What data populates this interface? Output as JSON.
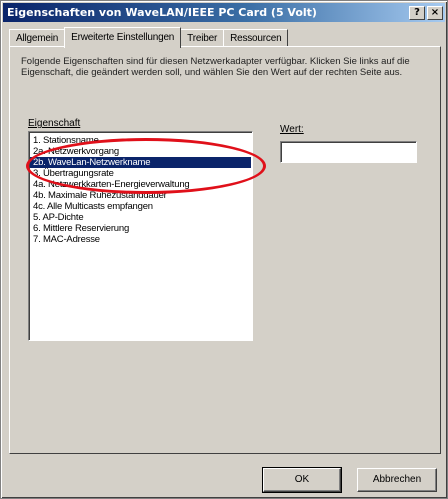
{
  "window": {
    "title": "Eigenschaften von WaveLAN/IEEE PC Card (5 Volt)",
    "help_label": "?",
    "close_label": "×"
  },
  "tabs": [
    {
      "label": "Allgemein"
    },
    {
      "label": "Erweiterte Einstellungen"
    },
    {
      "label": "Treiber"
    },
    {
      "label": "Ressourcen"
    }
  ],
  "description": "Folgende Eigenschaften sind für diesen Netzwerkadapter verfügbar. Klicken Sie links auf die Eigenschaft, die geändert werden soll, und wählen Sie den Wert auf der rechten Seite aus.",
  "property_label": "Eigenschaft",
  "value_label": "Wert:",
  "value_field": "",
  "properties": [
    {
      "label": "1. Stationsname"
    },
    {
      "label": "2a. Netzwerkvorgang"
    },
    {
      "label": "2b. WaveLan-Netzwerkname"
    },
    {
      "label": "3. Übertragungsrate"
    },
    {
      "label": "4a. Netzwerkkarten-Energieverwaltung"
    },
    {
      "label": "4b. Maximale Ruhezustanddauer"
    },
    {
      "label": "4c. Alle Multicasts empfangen"
    },
    {
      "label": "5. AP-Dichte"
    },
    {
      "label": "6. Mittlere Reservierung"
    },
    {
      "label": "7. MAC-Adresse"
    }
  ],
  "selected_index": 2,
  "buttons": {
    "ok": "OK",
    "cancel": "Abbrechen"
  },
  "colors": {
    "highlight_ellipse": "#e0101a",
    "selection": "#0a246a"
  }
}
